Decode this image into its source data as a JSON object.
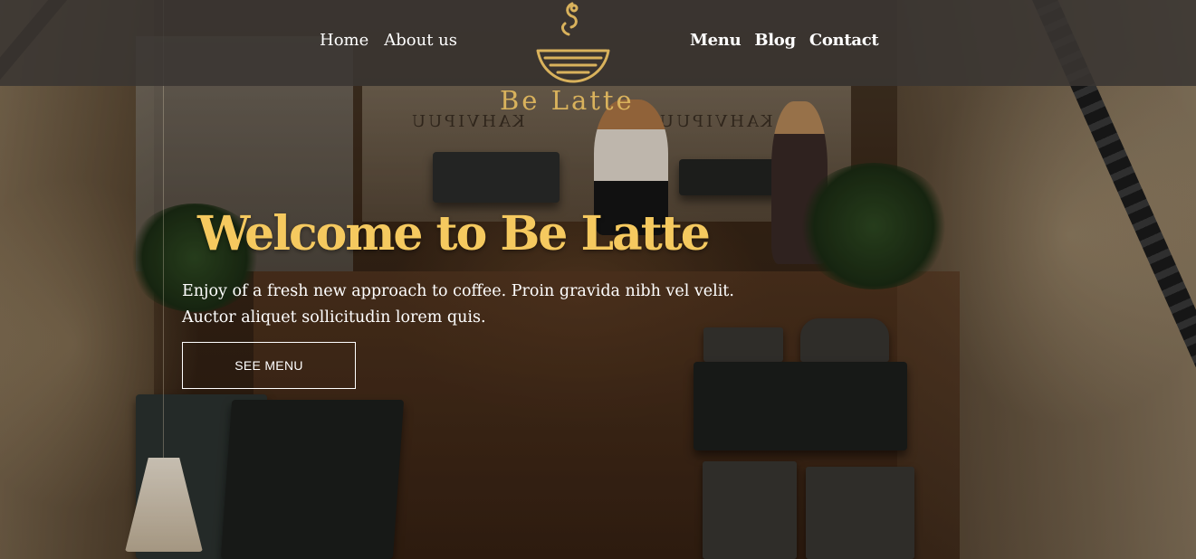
{
  "nav": {
    "left": [
      {
        "label": "Home"
      },
      {
        "label": "About us"
      }
    ],
    "right": [
      {
        "label": "Menu"
      },
      {
        "label": "Blog"
      },
      {
        "label": "Contact"
      }
    ]
  },
  "brand": {
    "name": "Be Latte",
    "logo_icon": "coffee-cup-icon",
    "color": "#d9b25c"
  },
  "hero": {
    "title": "Welcome to Be Latte",
    "text_line1": "Enjoy of a fresh new approach to coffee. Proin gravida nibh vel velit.",
    "text_line2": "Auctor aliquet sollicitudin lorem quis.",
    "cta_label": "SEE MENU",
    "title_color": "#f5c95f"
  },
  "background": {
    "window_lettering_1": "KAHVIPUU",
    "window_lettering_2": "KAHVIPUU"
  }
}
